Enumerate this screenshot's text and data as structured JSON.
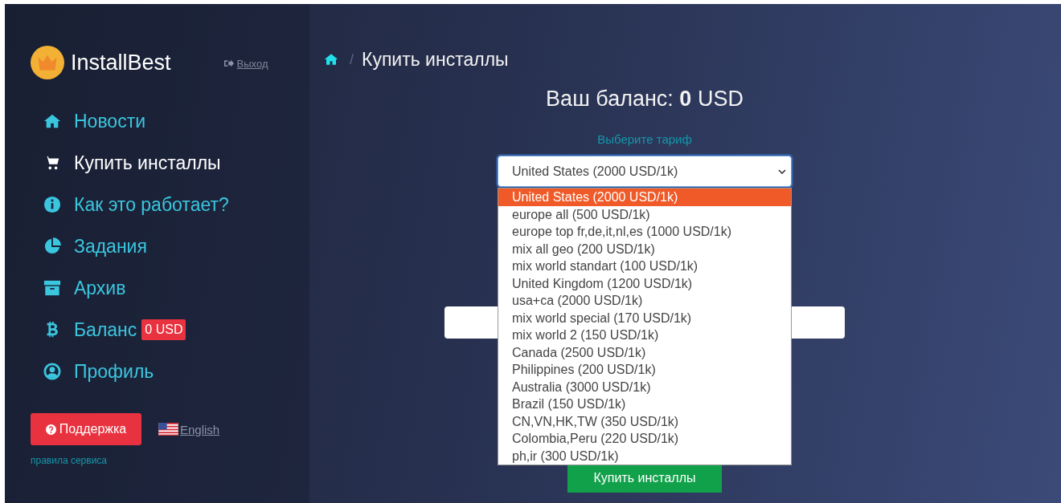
{
  "brand": {
    "name": "InstallBest",
    "logout": "Выход"
  },
  "nav": [
    {
      "label": "Новости",
      "selected": false
    },
    {
      "label": "Купить инсталлы",
      "selected": true
    },
    {
      "label": "Как это работает?",
      "selected": false
    },
    {
      "label": "Задания",
      "selected": false
    },
    {
      "label": "Архив",
      "selected": false
    },
    {
      "label": "Баланс",
      "selected": false,
      "badge": "0 USD"
    },
    {
      "label": "Профиль",
      "selected": false
    }
  ],
  "support_button": "Поддержка",
  "language_link": "English",
  "rules_link": "правила сервиса",
  "breadcrumb": {
    "separator": "/",
    "current": "Купить инсталлы"
  },
  "balance_title": "Ваш баланс: **0** USD",
  "tariff_label": "Выберите тариф",
  "tariff_select": {
    "value": "United States (2000 USD/1k)",
    "expanded": true,
    "options": [
      {
        "label": "United States (2000 USD/1k)",
        "selected": true
      },
      {
        "label": "europe all (500 USD/1k)",
        "selected": false
      },
      {
        "label": "europe top fr,de,it,nl,es (1000 USD/1k)",
        "selected": false
      },
      {
        "label": "mix all geo (200 USD/1k)",
        "selected": false
      },
      {
        "label": "mix world standart (100 USD/1k)",
        "selected": false
      },
      {
        "label": "United Kingdom (1200 USD/1k)",
        "selected": false
      },
      {
        "label": "usa+ca (2000 USD/1k)",
        "selected": false
      },
      {
        "label": "mix world special (170 USD/1k)",
        "selected": false
      },
      {
        "label": "mix world 2 (150 USD/1k)",
        "selected": false
      },
      {
        "label": "Canada (2500 USD/1k)",
        "selected": false
      },
      {
        "label": "Philippines (200 USD/1k)",
        "selected": false
      },
      {
        "label": "Australia (3000 USD/1k)",
        "selected": false
      },
      {
        "label": "Brazil (150 USD/1k)",
        "selected": false
      },
      {
        "label": "CN,VN,HK,TW (350 USD/1k)",
        "selected": false
      },
      {
        "label": "Colombia,Peru (220 USD/1k)",
        "selected": false
      },
      {
        "label": "ph,ir (300 USD/1k)",
        "selected": false
      }
    ]
  },
  "buy_button": "Купить инсталлы"
}
